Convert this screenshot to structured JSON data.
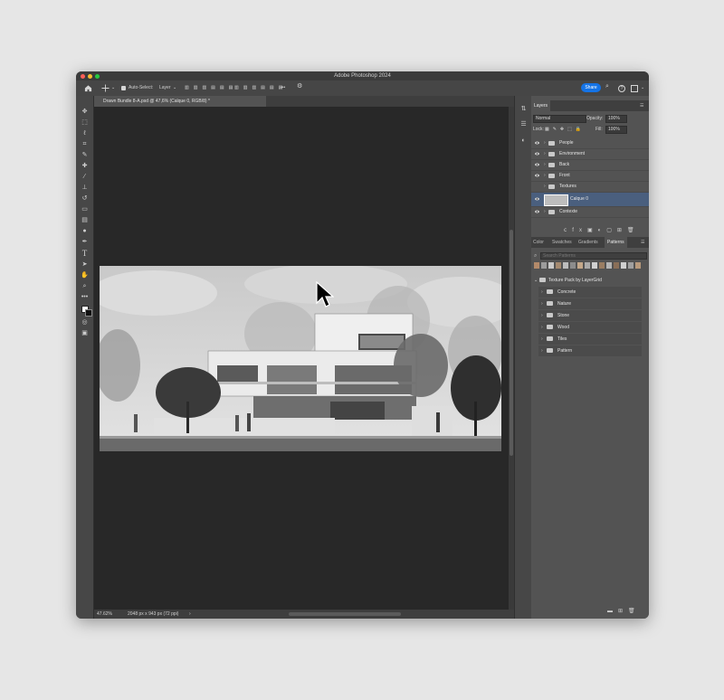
{
  "app": {
    "title": "Adobe Photoshop 2024"
  },
  "options_bar": {
    "auto_select_label": "Auto-Select:",
    "auto_select_target": "Layer",
    "more": "•••",
    "share_label": "Share"
  },
  "document": {
    "tab_title": "Drawn Bundle 8-A.psd @ 47,6% (Calque 0, RGB/8) *",
    "zoom": "47.62%",
    "dimensions": "2048 px x 943 px (72 ppi)"
  },
  "layers_panel": {
    "tab_label": "Layers",
    "blend_mode": "Normal",
    "opacity_label": "Opacity:",
    "opacity_value": "100%",
    "lock_label": "Lock:",
    "fill_label": "Fill:",
    "fill_value": "100%",
    "layers": [
      {
        "name": "People",
        "type": "group"
      },
      {
        "name": "Environment",
        "type": "group"
      },
      {
        "name": "Back",
        "type": "group"
      },
      {
        "name": "Front",
        "type": "group"
      },
      {
        "name": "Textures",
        "type": "group"
      },
      {
        "name": "Calque 0",
        "type": "layer",
        "selected": true
      },
      {
        "name": "Contexte",
        "type": "group"
      }
    ]
  },
  "patterns_panel": {
    "tabs": [
      "Color",
      "Swatches",
      "Gradients",
      "Patterns"
    ],
    "active_tab": "Patterns",
    "search_placeholder": "Search Patterns",
    "root_group": "Texture Pack by LayerGrid",
    "groups": [
      "Concrete",
      "Nature",
      "Stone",
      "Wood",
      "Tiles",
      "Pattern"
    ]
  },
  "colors": {
    "accent": "#1473e6",
    "selection": "#4a5f7e",
    "panel_bg": "#535353",
    "canvas_bg": "#282828"
  }
}
